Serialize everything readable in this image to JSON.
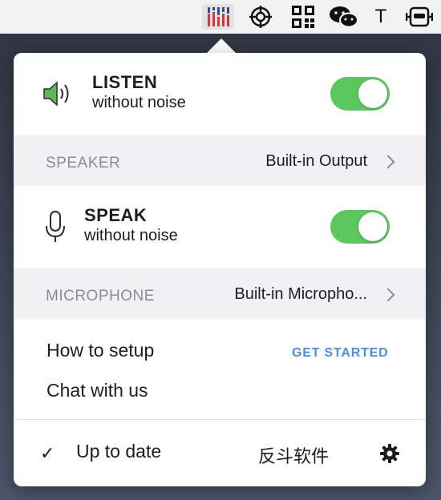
{
  "menubar": {
    "icons": [
      "equalizer-icon",
      "target-icon",
      "qr-icon",
      "wechat-icon",
      "text-icon",
      "robot-icon"
    ],
    "text_icon_label": "T"
  },
  "listen": {
    "title": "LISTEN",
    "subtitle": "without noise",
    "enabled": true
  },
  "speaker": {
    "label": "SPEAKER",
    "value": "Built-in Output"
  },
  "speak": {
    "title": "SPEAK",
    "subtitle": "without noise",
    "enabled": true
  },
  "microphone": {
    "label": "MICROPHONE",
    "value": "Built-in Micropho..."
  },
  "links": {
    "setup": "How to setup",
    "get_started": "GET STARTED",
    "chat": "Chat with us"
  },
  "footer": {
    "check": "✓",
    "status": "Up to date",
    "brand": "反斗软件"
  },
  "colors": {
    "toggle_on": "#5bc85d",
    "speaker_icon": "#5bb85c",
    "link": "#4a90e2",
    "equalizer_blue": "#2f4e8c",
    "equalizer_red": "#d0393a"
  }
}
